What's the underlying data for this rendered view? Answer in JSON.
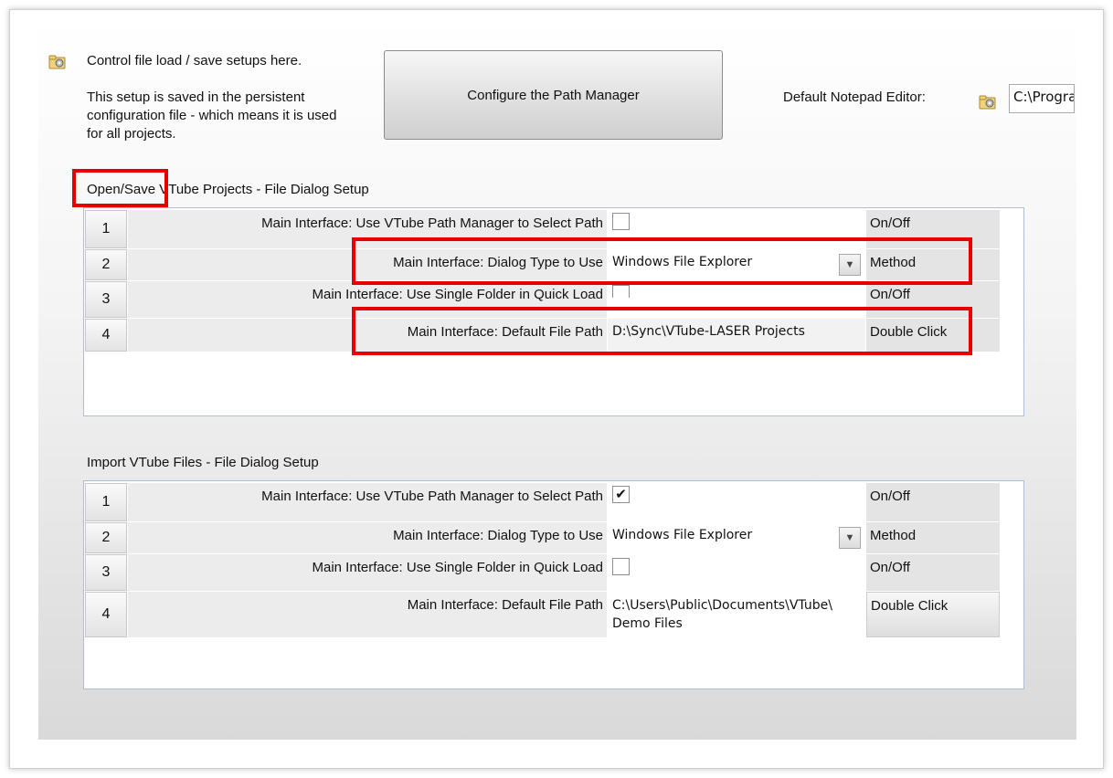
{
  "header": {
    "intro_line": "Control file load / save setups here.",
    "intro_detail": "This setup is saved in the persistent configuration file - which means it is used for all projects.",
    "path_manager_button": "Configure the Path Manager",
    "notepad_label": "Default Notepad Editor:",
    "notepad_value": "C:\\Progra"
  },
  "section_open_save": {
    "title": "Open/Save VTube Projects - File Dialog Setup",
    "rows": [
      {
        "num": "1",
        "label": "Main Interface: Use VTube Path Manager to Select Path",
        "value": "",
        "checked": false,
        "unit": "On/Off"
      },
      {
        "num": "2",
        "label": "Main Interface: Dialog Type to Use",
        "value": "Windows File Explorer",
        "unit": "Method"
      },
      {
        "num": "3",
        "label": "Main Interface: Use Single Folder in Quick Load",
        "value": "",
        "checked": false,
        "unit": "On/Off"
      },
      {
        "num": "4",
        "label": "Main Interface: Default File Path",
        "value": "D:\\Sync\\VTube-LASER Projects",
        "unit": "Double Click"
      }
    ]
  },
  "section_import": {
    "title": "Import VTube Files - File Dialog Setup",
    "rows": [
      {
        "num": "1",
        "label": "Main Interface: Use VTube Path Manager to Select Path",
        "value": "",
        "checked": true,
        "check_mark": "✔",
        "unit": "On/Off"
      },
      {
        "num": "2",
        "label": "Main Interface: Dialog Type to Use",
        "value": "Windows File Explorer",
        "unit": "Method"
      },
      {
        "num": "3",
        "label": "Main Interface: Use Single Folder in Quick Load",
        "value": "",
        "checked": false,
        "unit": "On/Off"
      },
      {
        "num": "4",
        "label": "Main Interface: Default File Path",
        "value_line1": "C:\\Users\\Public\\Documents\\VTube\\",
        "value_line2": "Demo Files",
        "unit": "Double Click"
      }
    ]
  },
  "icons": {
    "config": "gear-folder-icon",
    "dropdown": "chevron-down-icon"
  },
  "colors": {
    "highlight": "#e60000",
    "grid_border": "#a9c0d6"
  }
}
